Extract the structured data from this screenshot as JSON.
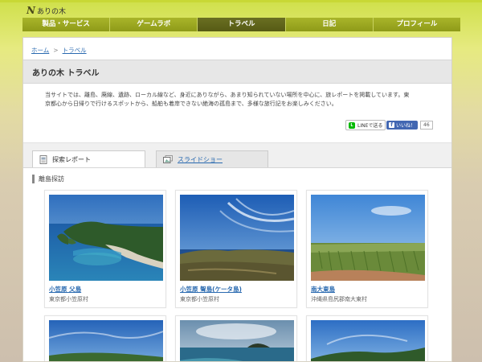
{
  "site": {
    "logo_mark": "N",
    "logo_text": "ありの木"
  },
  "nav": {
    "items": [
      {
        "label": "製品・サービス"
      },
      {
        "label": "ゲームラボ"
      },
      {
        "label": "トラベル"
      },
      {
        "label": "日記"
      },
      {
        "label": "プロフィール"
      }
    ],
    "active_index": 2
  },
  "breadcrumb": {
    "home": "ホーム",
    "separator": ">",
    "current": "トラベル"
  },
  "page": {
    "title": "ありの木 トラベル",
    "intro_line1": "当サイトでは、離島、廃線、遺跡、ローカル線など、身近にありながら、あまり知られていない場所を中心に、旅レポートを掲載しています。東",
    "intro_line2": "京都心から日帰りで行けるスポットから、船舶も着岸できない絶海の孤島まで、多様な旅行記をお楽しみください。"
  },
  "share": {
    "line_label": "LINEで送る",
    "line_icon": "line-icon",
    "fb_label": "いいね！",
    "fb_count": "46"
  },
  "tabs": {
    "report": "探索レポート",
    "slideshow": "スライドショー"
  },
  "section": {
    "title": "離島探訪"
  },
  "cards": [
    {
      "name": "小笠原 父島",
      "location": "東京都小笠原村"
    },
    {
      "name": "小笠原 聟島(ケータ島)",
      "location": "東京都小笠原村"
    },
    {
      "name": "南大東島",
      "location": "沖縄県島尻郡南大東村"
    },
    {
      "name": "",
      "location": ""
    },
    {
      "name": "",
      "location": ""
    },
    {
      "name": "",
      "location": ""
    }
  ],
  "colors": {
    "nav_bg": "#98a41f",
    "nav_active": "#5e6319",
    "link": "#2a6ab0",
    "accent_bar": "#c8d835"
  }
}
